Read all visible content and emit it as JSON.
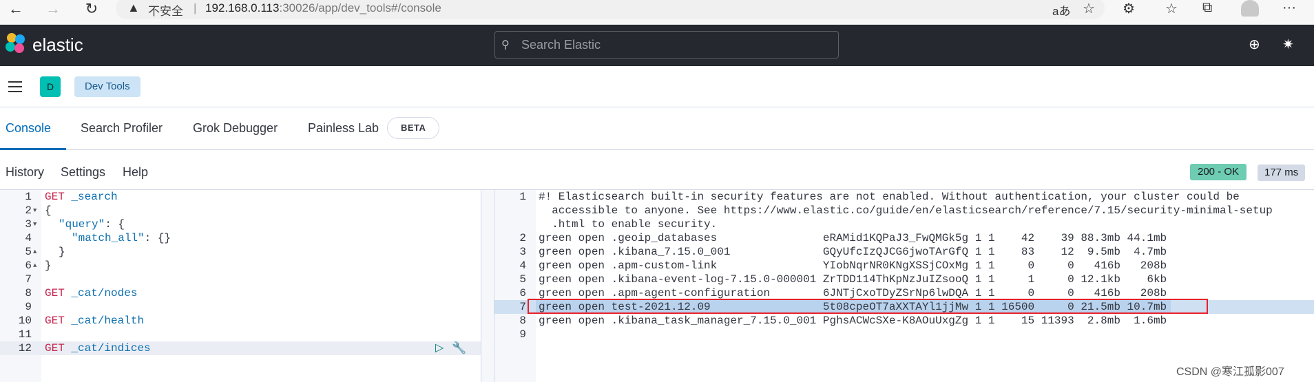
{
  "browser": {
    "security_label": "不安全",
    "url_host": "192.168.0.113",
    "url_rest": ":30026/app/dev_tools#/console",
    "back_icon": "←",
    "forward_icon": "→",
    "reload_icon": "↻",
    "warning_icon": "▲",
    "read_aloud_icon": "aあ",
    "favorite_add_icon": "☆",
    "extensions_icon": "⚙",
    "favorites_icon": "☆",
    "collections_icon": "⧉",
    "more_icon": "···"
  },
  "header": {
    "brand": "elastic",
    "search_placeholder": "Search Elastic",
    "search_icon": "⚲",
    "help_icon": "⊕",
    "news_icon": "✷",
    "logo_colors": [
      "#f0b92b",
      "#1ba9f5",
      "#00bfb3",
      "#ee5097"
    ]
  },
  "subheader": {
    "space_initial": "D",
    "breadcrumb": "Dev Tools"
  },
  "tabs": {
    "console": "Console",
    "search_profiler": "Search Profiler",
    "grok_debugger": "Grok Debugger",
    "painless_lab": "Painless Lab",
    "beta": "BETA"
  },
  "toolbar": {
    "history": "History",
    "settings": "Settings",
    "help": "Help",
    "status": "200 - OK",
    "timing": "177 ms"
  },
  "request": {
    "line_numbers": [
      "1",
      "2",
      "3",
      "4",
      "5",
      "6",
      "7",
      "8",
      "9",
      "10",
      "11",
      "12"
    ],
    "l1_method": "GET",
    "l1_path": "_search",
    "l2": "{",
    "l3_key": "\"query\"",
    "l3_rest": ": {",
    "l4_key": "\"match_all\"",
    "l4_rest": ": {}",
    "l5": "}",
    "l6": "}",
    "l8_method": "GET",
    "l8_path": "_cat/nodes",
    "l10_method": "GET",
    "l10_path": "_cat/health",
    "l12_method": "GET",
    "l12_path": "_cat/indices",
    "run_icon": "▷",
    "wrench_icon": "🔧"
  },
  "response": {
    "line_numbers": [
      "1",
      "2",
      "3",
      "4",
      "5",
      "6",
      "7",
      "8",
      "9"
    ],
    "l1a": "#! Elasticsearch built-in security features are not enabled. Without authentication, your cluster could be",
    "l1b": "  accessible to anyone. See https://www.elastic.co/guide/en/elasticsearch/reference/7.15/security-minimal-setup",
    "l1c": "  .html to enable security.",
    "rows": [
      "green open .geoip_databases                eRAMid1KQPaJ3_FwQMGk5g 1 1    42    39 88.3mb 44.1mb",
      "green open .kibana_7.15.0_001              GQyUfcIzQJCG6jwoTArGfQ 1 1    83    12  9.5mb  4.7mb",
      "green open .apm-custom-link                YIobNqrNR0KNgXSSjCOxMg 1 1     0     0   416b   208b",
      "green open .kibana-event-log-7.15.0-000001 ZrTDD114ThKpNzJuIZsooQ 1 1     1     0 12.1kb    6kb",
      "green open .apm-agent-configuration        6JNTjCxoTDyZSrNp6lwDQA 1 1     0     0   416b   208b",
      "green open test-2021.12.09                 5t08cpeOT7aXXTAYl1jjMw 1 1 16500     0 21.5mb 10.7mb",
      "green open .kibana_task_manager_7.15.0_001 PghsACWcSXe-K8AOuUxgZg 1 1    15 11393  2.8mb  1.6mb"
    ]
  },
  "watermark": "CSDN @寒江孤影007"
}
